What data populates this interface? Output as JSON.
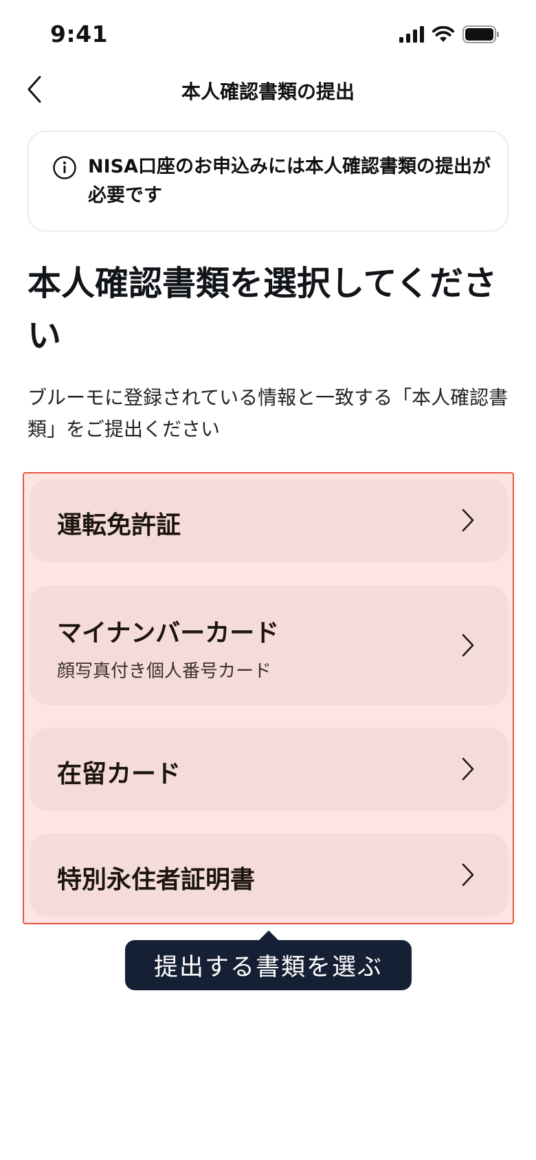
{
  "status_bar": {
    "time": "9:41"
  },
  "nav": {
    "title": "本人確認書類の提出"
  },
  "notice": {
    "text": "NISA口座のお申込みには本人確認書類の提出が必要です"
  },
  "heading": "本人確認書類を選択してください",
  "description": "ブルーモに登録されている情報と一致する「本人確認書類」をご提出ください",
  "options": [
    {
      "title": "運転免許証",
      "subtitle": ""
    },
    {
      "title": "マイナンバーカード",
      "subtitle": "顔写真付き個人番号カード"
    },
    {
      "title": "在留カード",
      "subtitle": ""
    },
    {
      "title": "特別永住者証明書",
      "subtitle": ""
    }
  ],
  "tooltip": {
    "text": "提出する書類を選ぶ"
  },
  "colors": {
    "highlight_border": "#e8553a",
    "highlight_fill": "#fde6e2",
    "card_fill": "#f5dcd8",
    "tooltip_bg": "#162034"
  },
  "icons": [
    "signal-icon",
    "wifi-icon",
    "battery-icon",
    "back-chevron-icon",
    "info-icon",
    "chevron-right-icon"
  ]
}
